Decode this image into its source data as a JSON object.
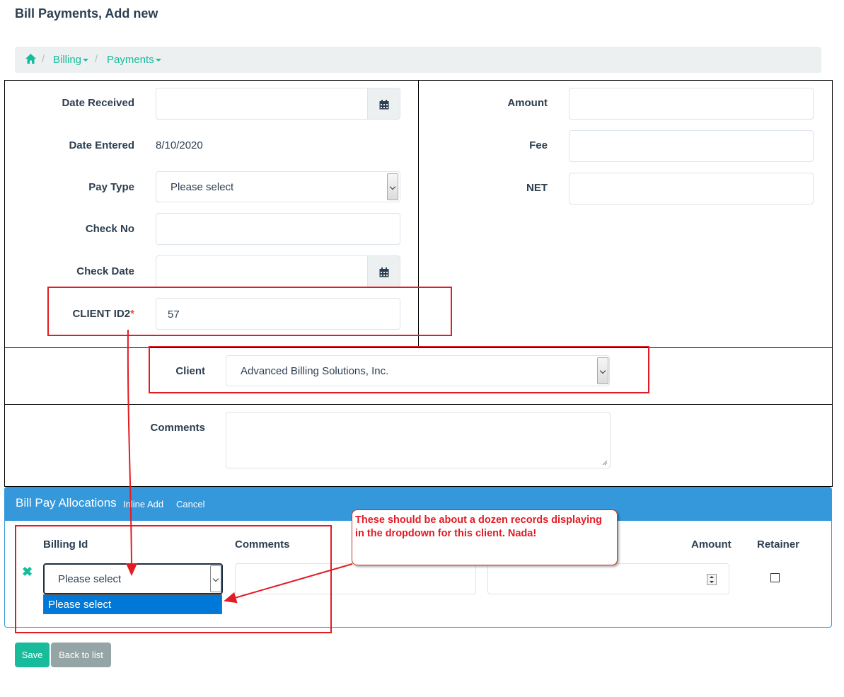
{
  "page": {
    "title": "Bill Payments, Add new"
  },
  "breadcrumb": {
    "billing": "Billing",
    "payments": "Payments"
  },
  "form": {
    "date_received": {
      "label": "Date Received",
      "value": ""
    },
    "date_entered": {
      "label": "Date Entered",
      "value": "8/10/2020"
    },
    "pay_type": {
      "label": "Pay Type",
      "selected": "Please select"
    },
    "check_no": {
      "label": "Check No",
      "value": ""
    },
    "check_date": {
      "label": "Check Date",
      "value": ""
    },
    "client_id2": {
      "label": "CLIENT ID2",
      "required_mark": "*",
      "value": "57"
    },
    "amount": {
      "label": "Amount",
      "value": ""
    },
    "fee": {
      "label": "Fee",
      "value": ""
    },
    "net": {
      "label": "NET",
      "value": ""
    },
    "client": {
      "label": "Client",
      "selected": "Advanced Billing Solutions, Inc."
    },
    "comments": {
      "label": "Comments",
      "value": ""
    }
  },
  "allocations": {
    "title": "Bill Pay Allocations",
    "inline_add": "Inline Add",
    "cancel": "Cancel",
    "columns": {
      "billing_id": "Billing Id",
      "comments": "Comments",
      "amount": "Amount",
      "retainer": "Retainer"
    },
    "row": {
      "billing_id_selected": "Please select",
      "dropdown_option": "Please select",
      "retainer_checked": false
    }
  },
  "annotation": {
    "callout_text": "These should be about a dozen records displaying in the dropdown for this client. Nada!"
  },
  "buttons": {
    "save": "Save",
    "back": "Back to list"
  },
  "colors": {
    "accent": "#18bc9c",
    "panel": "#3498db",
    "annotation": "#e31b23",
    "selection": "#0078d7"
  }
}
